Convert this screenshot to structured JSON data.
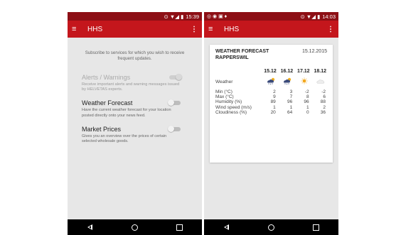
{
  "left_screen": {
    "status": {
      "time": "15:39",
      "icons": "⊙ ▼◢ ▮"
    },
    "appbar": {
      "title": "HHS",
      "more": "⋮",
      "menu": "≡"
    },
    "intro": "Subscribe to services for which you wish to receive frequent updates.",
    "services": [
      {
        "name": "Alerts / Warnings",
        "desc": "Receive important alerts and warning messages issued by HELVETAS experts.",
        "toggle": "on",
        "enabled": false
      },
      {
        "name": "Weather Forecast",
        "desc": "Have the current weather forecast for your location posted directly onto your news feed.",
        "toggle": "off",
        "enabled": true
      },
      {
        "name": "Market Prices",
        "desc": "Gives you an overview over the prices of certain selected wholesale goods.",
        "toggle": "off",
        "enabled": true
      }
    ]
  },
  "right_screen": {
    "status": {
      "time": "14:03",
      "icons": "⊙ ▼◢ ▮",
      "left_icons": "◎ ◉ ▣ ♦"
    },
    "appbar": {
      "title": "HHS",
      "more": "⋮",
      "menu": "≡"
    },
    "card": {
      "title_line1": "WEATHER FORECAST",
      "title_line2": "RAPPERSWIL",
      "date": "15.12.2015",
      "columns": [
        "15.12",
        "16.12",
        "17.12",
        "18.12"
      ],
      "weather_label": "Weather",
      "weather_icons": [
        "cloud-snow-sun-icon",
        "cloud-snow-sun-icon",
        "sun-icon",
        "cloud-icon"
      ],
      "rows": [
        {
          "label": "Min (°C)",
          "values": [
            "2",
            "3",
            "-2",
            "-2"
          ]
        },
        {
          "label": "Max (°C)",
          "values": [
            "9",
            "7",
            "8",
            "6"
          ]
        },
        {
          "label": "Humidity (%)",
          "values": [
            "89",
            "96",
            "96",
            "88"
          ]
        },
        {
          "label": "Wind speed (m/s)",
          "values": [
            "1",
            "1",
            "1",
            "2"
          ]
        },
        {
          "label": "Cloudiness (%)",
          "values": [
            "20",
            "64",
            "0",
            "36"
          ]
        }
      ]
    }
  },
  "colors": {
    "statusbar": "#8d0f15",
    "appbar": "#c4161c",
    "content_bg": "#e7e7e7"
  }
}
